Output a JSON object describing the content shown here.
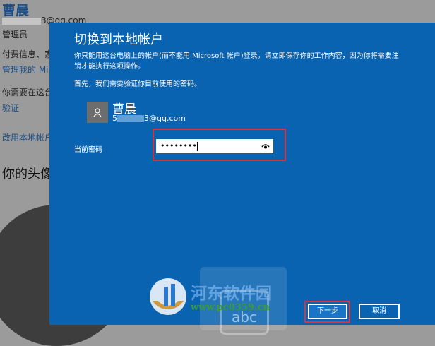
{
  "background": {
    "user_name": "曹晨",
    "email_suffix": "3@qq.com",
    "role": "管理员",
    "billing": "付费信息、家",
    "manage_link": "管理我的 Mi",
    "need_text": "你需要在这台",
    "verify_link": "验证",
    "switch_link": "改用本地帐户",
    "avatar_heading": "你的头像"
  },
  "dialog": {
    "title": "切换到本地帐户",
    "description": "你只能用这台电脑上的帐户(而不能用 Microsoft 帐户)登录。请立即保存你的工作内容，因为你将需要注销才能执行这项操作。",
    "first_text": "首先，我们需要验证你目前使用的密码。",
    "account_name": "曹晨",
    "account_email_prefix": "5",
    "account_email_suffix": "3@qq.com",
    "password_label": "当前密码",
    "password_value": "••••••••",
    "next_button": "下一步",
    "cancel_button": "取消"
  },
  "keyboard": {
    "label": "abc"
  },
  "watermark": {
    "name": "河东软件园",
    "url": "www.pc0359.cn"
  },
  "colors": {
    "dialog_bg": "#0a63b1",
    "highlight": "#d9343a"
  }
}
